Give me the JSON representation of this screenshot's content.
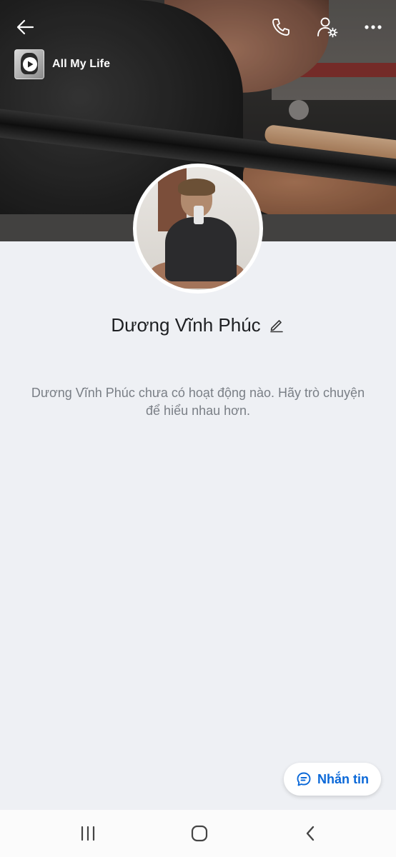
{
  "music": {
    "title": "All My Life",
    "thumb_icon": "play-icon"
  },
  "header": {
    "back_icon": "arrow-left-icon",
    "call_icon": "phone-icon",
    "settings_icon": "user-settings-icon",
    "more_icon": "more-dots-icon"
  },
  "profile": {
    "name": "Dương Vĩnh Phúc",
    "edit_icon": "pencil-icon"
  },
  "empty_state": {
    "message": "Dương Vĩnh Phúc chưa có hoạt động nào. Hãy trò chuyện để hiểu nhau hơn."
  },
  "actions": {
    "message_label": "Nhắn tin",
    "message_icon": "chat-bubble-icon"
  },
  "nav": {
    "recent_icon": "recent-apps-icon",
    "home_icon": "home-icon",
    "back_icon": "back-chevron-icon"
  },
  "colors": {
    "accent": "#0a68d8",
    "background": "#eef0f4",
    "text_primary": "#1d1f22",
    "text_secondary": "#7a7f86"
  }
}
